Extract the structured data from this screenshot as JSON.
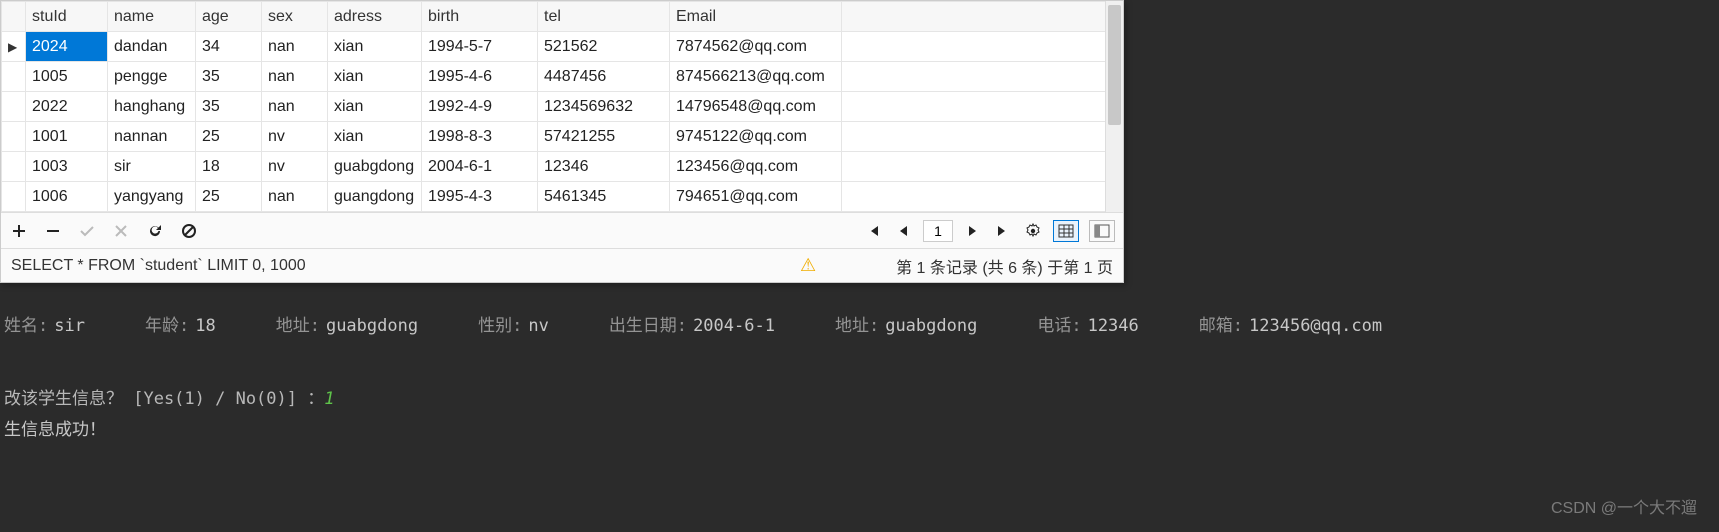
{
  "table": {
    "headers": [
      "stuId",
      "name",
      "age",
      "sex",
      "adress",
      "birth",
      "tel",
      "Email"
    ],
    "rows": [
      {
        "stuId": "2024",
        "name": "dandan",
        "age": "34",
        "sex": "nan",
        "adress": "xian",
        "birth": "1994-5-7",
        "tel": "521562",
        "email": "7874562@qq.com",
        "current": true
      },
      {
        "stuId": "1005",
        "name": "pengge",
        "age": "35",
        "sex": "nan",
        "adress": "xian",
        "birth": "1995-4-6",
        "tel": "4487456",
        "email": "874566213@qq.com"
      },
      {
        "stuId": "2022",
        "name": "hanghang",
        "age": "35",
        "sex": "nan",
        "adress": "xian",
        "birth": "1992-4-9",
        "tel": "1234569632",
        "email": "14796548@qq.com"
      },
      {
        "stuId": "1001",
        "name": "nannan",
        "age": "25",
        "sex": "nv",
        "adress": "xian",
        "birth": "1998-8-3",
        "tel": "57421255",
        "email": "9745122@qq.com"
      },
      {
        "stuId": "1003",
        "name": "sir",
        "age": "18",
        "sex": "nv",
        "adress": "guabgdong",
        "birth": "2004-6-1",
        "tel": "12346",
        "email": "123456@qq.com"
      },
      {
        "stuId": "1006",
        "name": "yangyang",
        "age": "25",
        "sex": "nan",
        "adress": "guangdong",
        "birth": "1995-4-3",
        "tel": "5461345",
        "email": "794651@qq.com"
      }
    ]
  },
  "toolbar": {
    "page_value": "1"
  },
  "status": {
    "sql": "SELECT * FROM `student` LIMIT 0, 1000",
    "record_info": "第 1 条记录 (共 6 条) 于第 1 页"
  },
  "terminal": {
    "fields": [
      {
        "label": "姓名:",
        "value": "sir"
      },
      {
        "label": "年龄:",
        "value": "18"
      },
      {
        "label": "地址:",
        "value": "guabgdong"
      },
      {
        "label": "性别:",
        "value": "nv"
      },
      {
        "label": "出生日期:",
        "value": "2004-6-1"
      },
      {
        "label": "地址:",
        "value": "guabgdong"
      },
      {
        "label": "电话:",
        "value": "12346"
      },
      {
        "label": "邮箱:",
        "value": "123456@qq.com"
      }
    ],
    "prompt": "改该学生信息？ [Yes(1) / No(0)] ：",
    "input": "1",
    "success": "生信息成功！"
  },
  "watermark": "CSDN @一个大不遛"
}
